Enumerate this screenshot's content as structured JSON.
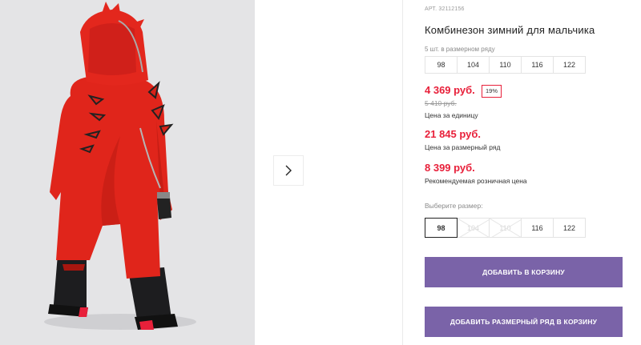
{
  "product": {
    "sku": "АРТ. 32112156",
    "title": "Комбинезон зимний для мальчика",
    "image_icon": "product-photo-red-dino-snowsuit"
  },
  "pack": {
    "label": "5 шт. в размерном ряду",
    "sizes": [
      "98",
      "104",
      "110",
      "116",
      "122"
    ]
  },
  "pricing": {
    "unit_price": "4 369 руб.",
    "discount": "19%",
    "old_price": "5 410 руб.",
    "unit_caption": "Цена за единицу",
    "pack_price": "21 845 руб.",
    "pack_caption": "Цена за размерный ряд",
    "rrp_price": "8 399 руб.",
    "rrp_caption": "Рекомендуемая розничная цена"
  },
  "size_select": {
    "label": "Выберите размер:",
    "options": [
      {
        "value": "98",
        "state": "selected"
      },
      {
        "value": "104",
        "state": "disabled"
      },
      {
        "value": "110",
        "state": "disabled"
      },
      {
        "value": "116",
        "state": "available"
      },
      {
        "value": "122",
        "state": "available"
      }
    ]
  },
  "buttons": {
    "add_to_cart": "ДОБАВИТЬ В КОРЗИНУ",
    "add_pack_to_cart": "ДОБАВИТЬ РАЗМЕРНЫЙ РЯД В КОРЗИНУ"
  },
  "colors": {
    "accent_red": "#e8203a",
    "button_purple": "#7a63a8"
  }
}
